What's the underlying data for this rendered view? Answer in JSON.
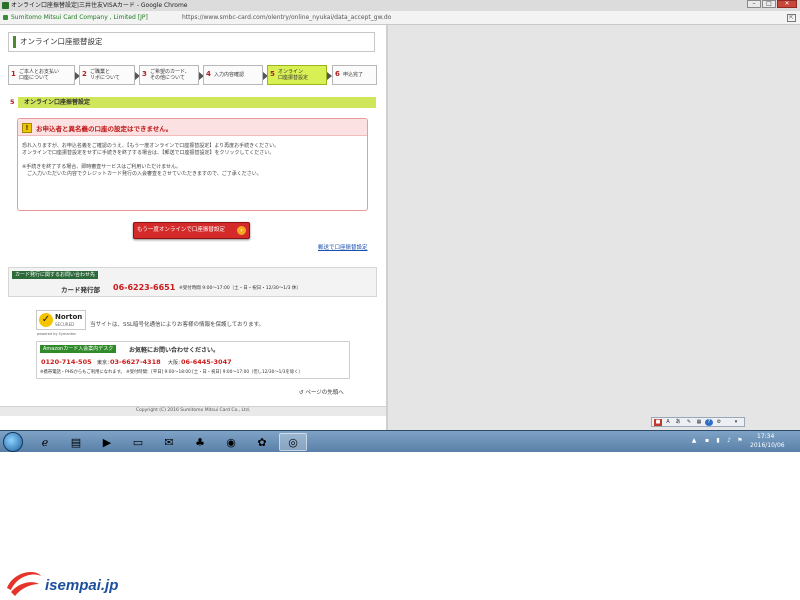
{
  "window": {
    "title": "オンライン口座振替設定|三井住友VISAカード - Google Chrome",
    "min_label": "–",
    "max_label": "□",
    "close_label": "✕"
  },
  "address": {
    "secure_label": "Sumitomo Mitsui Card Company , Limited [JP]",
    "url": "https://www.smbc-card.com/olentry/online_nyukai/data_accept_gw.do"
  },
  "page": {
    "title": "オンライン口座振替設定",
    "steps": [
      {
        "num": "1",
        "label": "ご本人とお支払い\n口座について"
      },
      {
        "num": "2",
        "label": "ご職業と\nリボについて"
      },
      {
        "num": "3",
        "label": "ご希望のカード、\nその他について"
      },
      {
        "num": "4",
        "label": "入力内容確認"
      },
      {
        "num": "5",
        "label": "オンライン\n口座振替設定"
      },
      {
        "num": "6",
        "label": "申込完了"
      }
    ],
    "section": {
      "num": "5",
      "label": "オンライン口座振替設定"
    },
    "notice": {
      "icon": "!",
      "title": "お申込者と異名義の口座の設定はできません。",
      "lines": [
        "恐れ入りますが、お申込名義をご確認のうえ、【もう一度オンラインで口座振替設定】より再度お手続きください。",
        "オンラインで口座振替設定をせずに手続きを終了する場合は、【郵送で口座振替設定】をクリックしてください。",
        "※手続きを終了する場合、即時審査サービスはご利用いただけません。",
        "　ご入力いただいた内容でクレジットカード発行の入会審査をさせていただきますので、ご了承ください。"
      ]
    },
    "retry_button": "もう一度オンラインで口座振替設定",
    "retry_icon": "›",
    "mail_link": "郵送で口座振替設定",
    "contact": {
      "tag": "カード発行に関するお問い合わせ先",
      "dept": "カード発行部",
      "phone": "06-6223-6651",
      "hours": "※受付時間 9:00～17:00（土・日・祝日・12/30～1/3 休）"
    },
    "norton": {
      "brand": "Norton",
      "secured": "SECURED",
      "powered": "powered by Symantec",
      "ssl_text": "当サイトは、SSL暗号化通信によりお客様の情報を保護しております。"
    },
    "amazon": {
      "tag": "Amazonカード入会案内デスク",
      "head": "お気軽にお問い合わせください。",
      "free_num": "0120-714-505",
      "tokyo_label": "東京：",
      "tokyo_num": "03-6627-4318",
      "osaka_label": "大阪：",
      "osaka_num": "06-6445-3047",
      "note": "※携帯電話・PHSからもご利用になれます。 ※受付時間：[平日] 9:00～18:00 [土・日・祝日] 9:00～17:00（但し12/30～1/3を除く）"
    },
    "page_top": "ページの先頭へ",
    "copyright": "Copyright (C) 2016 Sumitomo Mitsui Card Co., Ltd."
  },
  "langbar": {
    "mode": "あ",
    "lang": "A"
  },
  "taskbar": {
    "apps": [
      "ie-icon",
      "folder-icon",
      "media-player-icon",
      "computer-icon",
      "mail-icon",
      "games-icon",
      "firefox-icon",
      "green-app-icon",
      "chrome-icon"
    ],
    "time": "17:34",
    "date": "2016/10/06"
  },
  "logo": {
    "text": "isempai.jp"
  },
  "colors": {
    "accent_green": "#4b8a32",
    "step_active": "#d9f055",
    "error_red": "#c01515"
  }
}
